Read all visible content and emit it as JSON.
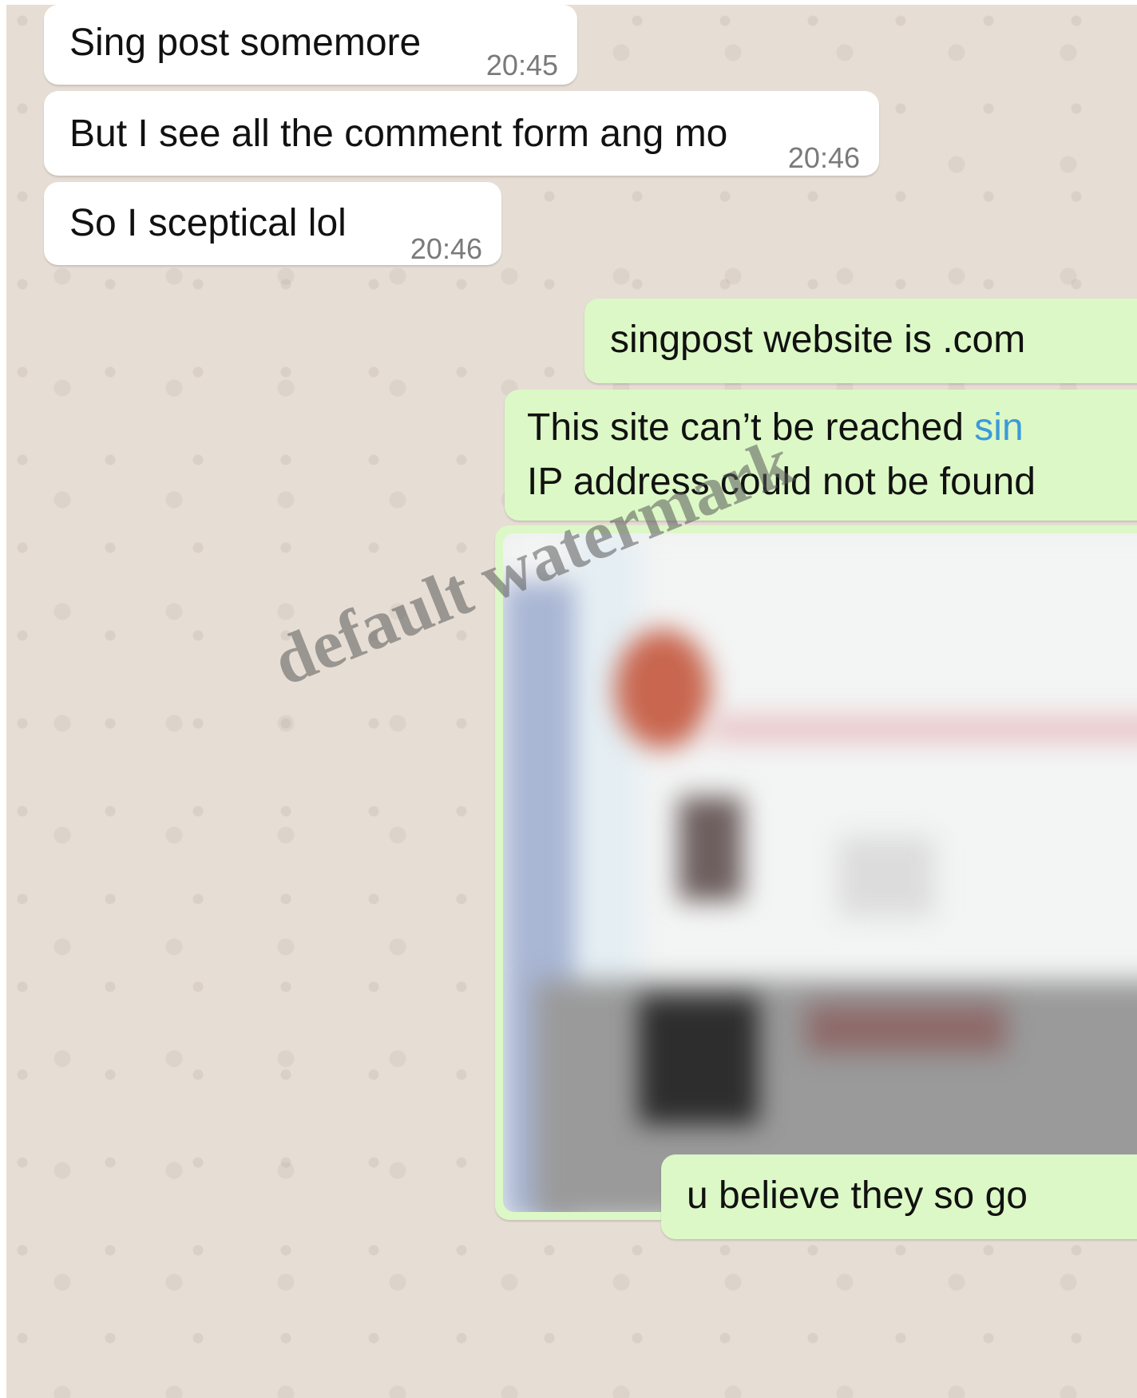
{
  "messages": [
    {
      "type": "incoming",
      "text": "Sing post somemore",
      "time": "20:45"
    },
    {
      "type": "incoming",
      "text": "But I see all the comment form ang mo",
      "time": "20:46"
    },
    {
      "type": "incoming",
      "text": "So I sceptical lol",
      "time": "20:46"
    },
    {
      "type": "outgoing",
      "text": "singpost website is .com"
    },
    {
      "type": "outgoing",
      "line1_text": "This site can’t be reached ",
      "line1_link": "sin",
      "line2_text": "IP address could not be found"
    },
    {
      "type": "outgoing-image",
      "description": "blurred screenshot"
    },
    {
      "type": "outgoing",
      "text": "u believe they so go"
    }
  ],
  "watermark": "default watermark",
  "colors": {
    "chat_background": "#e6ddd4",
    "incoming_bubble": "#ffffff",
    "outgoing_bubble": "#dcf8c6",
    "link": "#3b9ad8",
    "timestamp": "#7a7a7a"
  }
}
